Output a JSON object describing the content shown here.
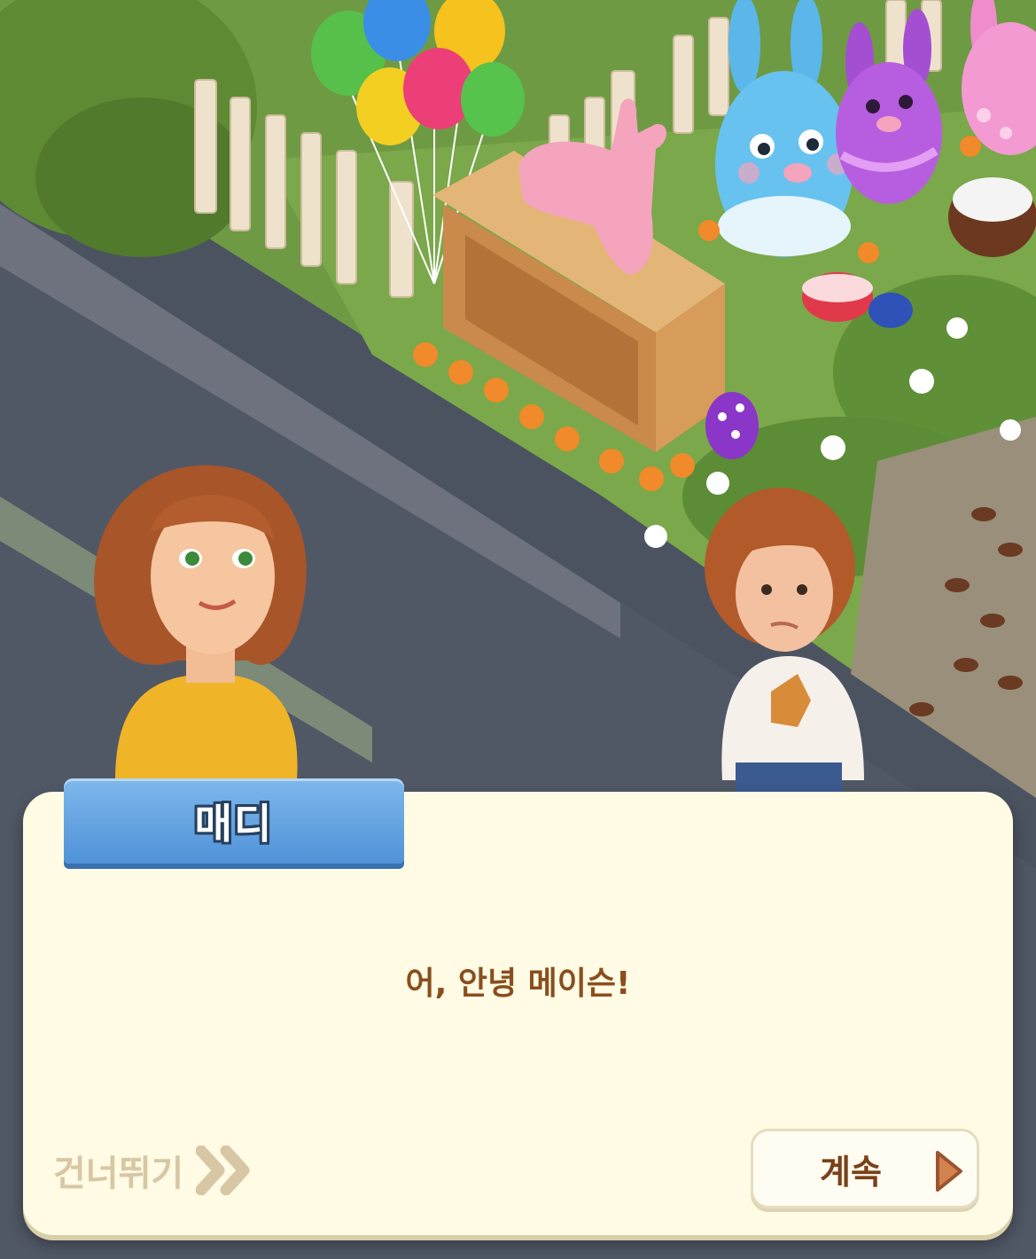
{
  "dialog": {
    "speaker_name": "매디",
    "message": "어, 안녕 메이슨!",
    "skip_label": "건너뛰기",
    "continue_label": "계속"
  },
  "icons": {
    "skip": "double-chevron-right-icon",
    "continue": "play-triangle-icon"
  },
  "colors": {
    "dialog_background": "#fffbe4",
    "nameplate": "#5b9de0",
    "message_text": "#8a4e1e",
    "skip_text": "#d8c7a4"
  }
}
